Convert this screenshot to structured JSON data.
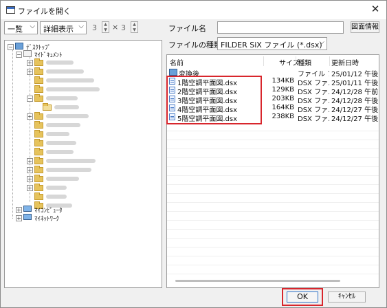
{
  "window": {
    "title": "ファイルを開く",
    "close_glyph": "✕"
  },
  "toolbar": {
    "view_select": "一覧",
    "detail_select": "詳細表示",
    "spin_rows": "3",
    "times": "×",
    "spin_cols": "3",
    "filename_label": "ファイル名",
    "filename_value": "",
    "filetype_label": "ファイルの種類",
    "filetype_value": "FILDER SiX ファイル (*.dsx)",
    "drawing_info_button": "図面情報"
  },
  "tree": {
    "root": "ﾃﾞｽｸﾄｯﾌﾟ",
    "mydocs": "ﾏｲﾄﾞｷｭﾒﾝﾄ",
    "mycomputer": "ﾏｲｺﾝﾋﾟｭｰﾀ",
    "network": "ﾏｲﾈｯﾄﾜｰｸ"
  },
  "filelist": {
    "columns": {
      "name": "名前",
      "size": "サイズ",
      "type": "種類",
      "date": "更新日時"
    },
    "rows": [
      {
        "name": "変換後",
        "size": "",
        "type": "ファイル フ...",
        "date": "25/01/12 午後"
      },
      {
        "name": "1階空調平面図.dsx",
        "size": "134KB",
        "type": "DSX ファ...",
        "date": "25/01/11 午後"
      },
      {
        "name": "2階空調平面図.dsx",
        "size": "129KB",
        "type": "DSX ファ...",
        "date": "24/12/28 午前"
      },
      {
        "name": "3階空調平面図.dsx",
        "size": "203KB",
        "type": "DSX ファ...",
        "date": "24/12/28 午後"
      },
      {
        "name": "4階空調平面図.dsx",
        "size": "164KB",
        "type": "DSX ファ...",
        "date": "24/12/27 午後"
      },
      {
        "name": "5階空調平面図.dsx",
        "size": "238KB",
        "type": "DSX ファ...",
        "date": "24/12/27 午後"
      }
    ]
  },
  "buttons": {
    "ok": "OK",
    "cancel": "ｷｬﾝｾﾙ"
  },
  "colors": {
    "highlight": "#d8262c",
    "folder": "#e6c35c"
  }
}
